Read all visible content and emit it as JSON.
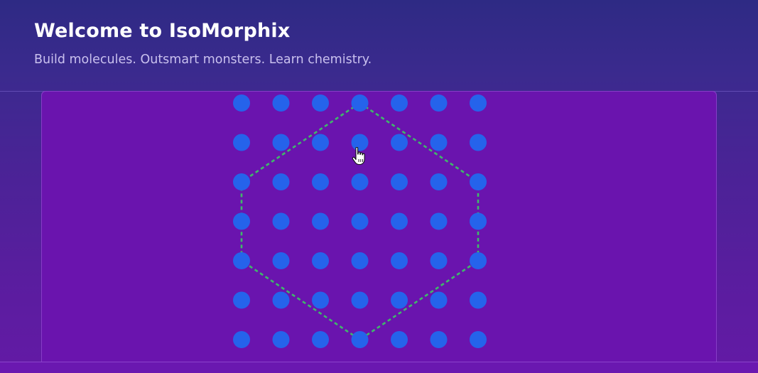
{
  "header": {
    "title": "Welcome to IsoMorphix",
    "subtitle": "Build molecules. Outsmart monsters. Learn chemistry."
  },
  "board": {
    "grid_rows": 7,
    "grid_cols": 7,
    "dot_color": "#2563eb",
    "background_color": "#6a14ae",
    "outline_color": "#3fb86b",
    "outline_shape": "hexagon",
    "outline_vertices": [
      [
        3,
        0
      ],
      [
        6,
        2
      ],
      [
        6,
        4
      ],
      [
        3,
        6
      ],
      [
        0,
        4
      ],
      [
        0,
        2
      ]
    ]
  },
  "cursor": {
    "icon": "hand-pointer-icon",
    "over_dot": [
      3,
      1
    ]
  }
}
